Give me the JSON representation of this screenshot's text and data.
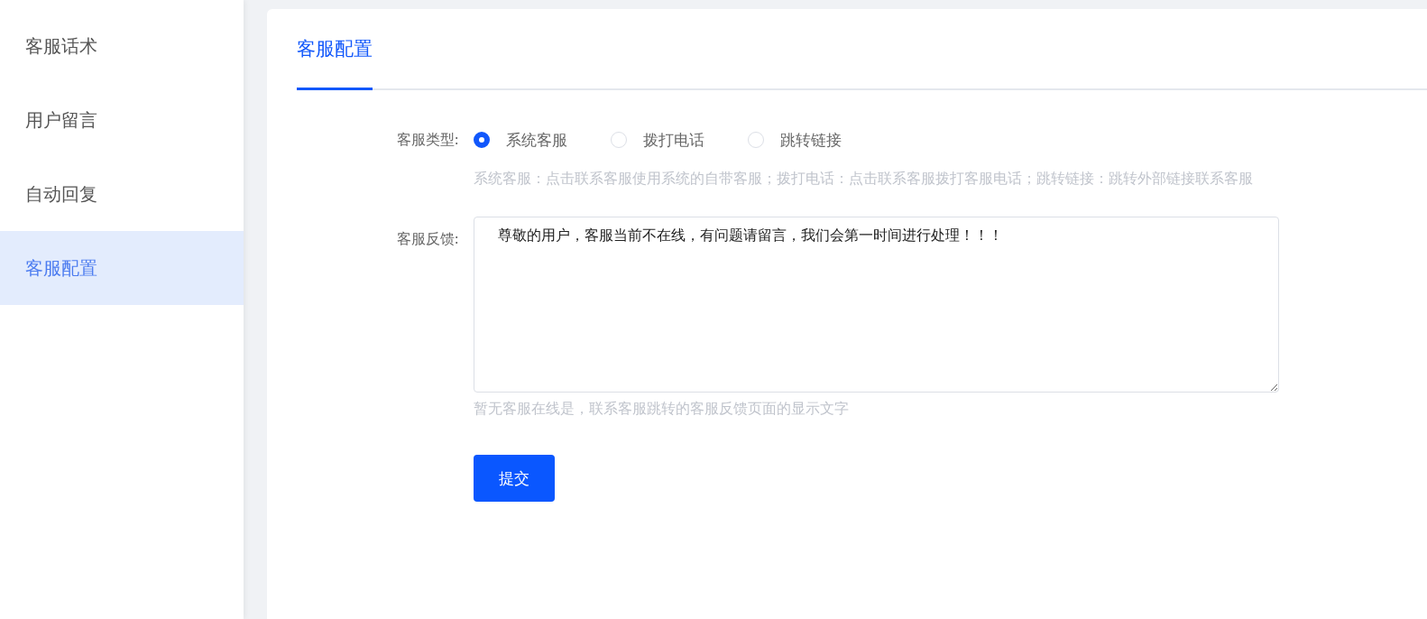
{
  "sidebar": {
    "items": [
      {
        "label": "客服话术",
        "selected": false
      },
      {
        "label": "用户留言",
        "selected": false
      },
      {
        "label": "自动回复",
        "selected": false
      },
      {
        "label": "客服配置",
        "selected": true
      }
    ]
  },
  "tabs": [
    {
      "label": "客服配置",
      "selected": true
    }
  ],
  "form": {
    "type_field": {
      "label": "客服类型:",
      "options": [
        {
          "label": "系统客服",
          "selected": true
        },
        {
          "label": "拨打电话",
          "selected": false
        },
        {
          "label": "跳转链接",
          "selected": false
        }
      ],
      "help": "系统客服：点击联系客服使用系统的自带客服；拨打电话：点击联系客服拨打客服电话；跳转链接：跳转外部链接联系客服"
    },
    "feedback_field": {
      "label": "客服反馈:",
      "value": "尊敬的用户，客服当前不在线，有问题请留言，我们会第一时间进行处理！！！",
      "help": "暂无客服在线是，联系客服跳转的客服反馈页面的显示文字"
    },
    "submit": "提交"
  }
}
